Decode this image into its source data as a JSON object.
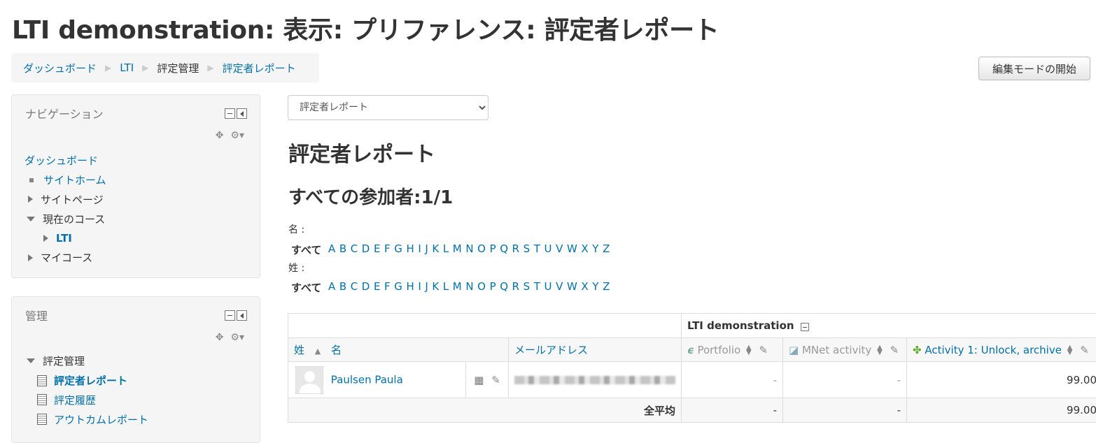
{
  "page_title": "LTI demonstration: 表示: プリファレンス: 評定者レポート",
  "breadcrumb": [
    {
      "label": "ダッシュボード",
      "link": true
    },
    {
      "label": "LTI",
      "link": true
    },
    {
      "label": "評定管理",
      "link": false
    },
    {
      "label": "評定者レポート",
      "link": true
    }
  ],
  "breadcrumb_separator": "▶",
  "edit_mode_button": "編集モードの開始",
  "nav_block": {
    "title": "ナビゲーション",
    "items": [
      "ダッシュボード",
      "サイトホーム",
      "サイトページ",
      "現在のコース",
      "LTI",
      "マイコース"
    ]
  },
  "admin_block": {
    "title": "管理",
    "items": [
      "評定管理",
      "評定者レポート",
      "評定履歴",
      "アウトカムレポート"
    ]
  },
  "report_select": {
    "value": "評定者レポート"
  },
  "report_heading": "評定者レポート",
  "participants_heading": "すべての参加者:1/1",
  "first_name_label": "名 :",
  "last_name_label": "姓 :",
  "initials_all": "すべて",
  "initials": [
    "A",
    "B",
    "C",
    "D",
    "E",
    "F",
    "G",
    "H",
    "I",
    "J",
    "K",
    "L",
    "M",
    "N",
    "O",
    "P",
    "Q",
    "R",
    "S",
    "T",
    "U",
    "V",
    "W",
    "X",
    "Y",
    "Z"
  ],
  "grade_table": {
    "course_header": "LTI demonstration",
    "col_lastname": "姓",
    "col_firstname": "名",
    "col_email": "メールアドレス",
    "col_portfolio": "Portfolio",
    "col_mnet": "MNet activity",
    "col_activity1": "Activity 1: Unlock, archive",
    "student_name": "Paulsen Paula",
    "portfolio_grade": "-",
    "mnet_grade": "-",
    "activity1_grade": "99.00",
    "overall_label": "全平均",
    "overall_portfolio": "-",
    "overall_mnet": "-",
    "overall_activity1": "99.00"
  }
}
